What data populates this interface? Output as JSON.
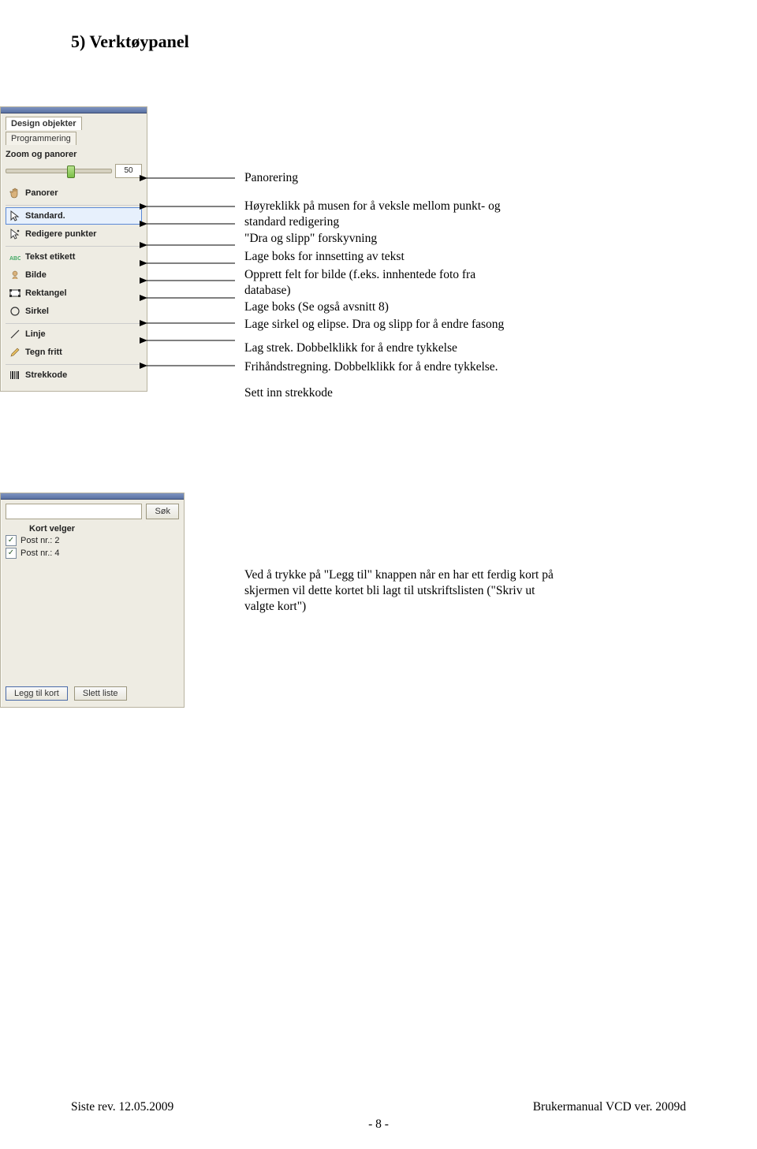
{
  "heading": "5) Verktøypanel",
  "panel": {
    "tabs": {
      "design": "Design objekter",
      "prog": "Programmering"
    },
    "zoom_label": "Zoom og panorer",
    "slider_val": "50",
    "tools": {
      "panorer": "Panorer",
      "standard": "Standard.",
      "redigere": "Redigere punkter",
      "tekst": "Tekst etikett",
      "bilde": "Bilde",
      "rektangel": "Rektangel",
      "sirkel": "Sirkel",
      "linje": "Linje",
      "tegn": "Tegn fritt",
      "strekkode": "Strekkode"
    }
  },
  "annotations": {
    "a1": "Panorering",
    "a2": "Høyreklikk på musen for å veksle mellom punkt- og standard redigering",
    "a3": "\"Dra og slipp\" forskyvning",
    "a4": "Lage boks for innsetting av tekst",
    "a5": "Opprett felt for bilde (f.eks. innhentede foto fra database)",
    "a6": "Lage boks (Se også avsnitt 8)",
    "a7": "Lage sirkel og elipse. Dra og slipp for å endre fasong",
    "a8": "Lag strek. Dobbelklikk for å endre tykkelse",
    "a9": "Frihåndstregning. Dobbelklikk for å endre tykkelse.",
    "a10": "Sett inn strekkode"
  },
  "panel2": {
    "sok": "Søk",
    "kort_velger": "Kort velger",
    "post2": "Post nr.: 2",
    "post4": "Post nr.: 4",
    "legg_til": "Legg til kort",
    "slett": "Slett liste"
  },
  "paragraph2": "Ved å trykke på \"Legg til\" knappen når en har ett ferdig kort på skjermen vil dette kortet bli lagt til utskriftslisten (\"Skriv ut valgte kort\")",
  "footer": {
    "left": "Siste rev. 12.05.2009",
    "right": "Brukermanual VCD ver. 2009d",
    "page": "- 8 -"
  }
}
